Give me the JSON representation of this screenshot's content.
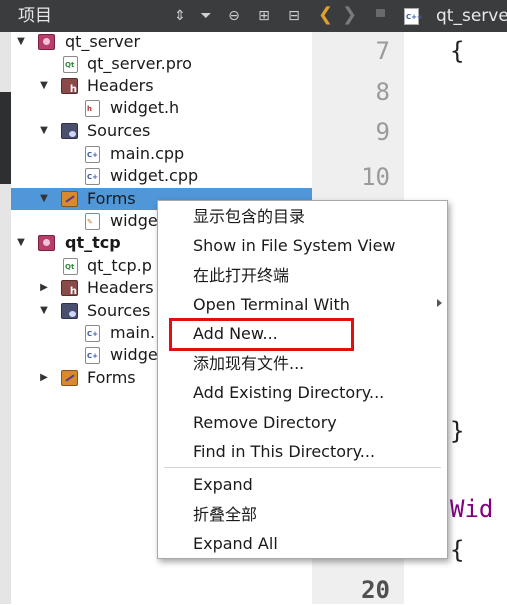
{
  "panel": {
    "title": "项目",
    "header_icons": [
      "sort-icon",
      "filter-icon",
      "link-icon",
      "split-icon",
      "close-pane-icon"
    ]
  },
  "tree": [
    {
      "label": "qt_server",
      "icon": "qt-project-icon",
      "expanded": true
    },
    {
      "label": "qt_server.pro",
      "icon": "pro-file-icon"
    },
    {
      "label": "Headers",
      "icon": "headers-folder-icon",
      "expanded": true
    },
    {
      "label": "widget.h",
      "icon": "header-file-icon"
    },
    {
      "label": "Sources",
      "icon": "sources-folder-icon",
      "expanded": true
    },
    {
      "label": "main.cpp",
      "icon": "cpp-file-icon"
    },
    {
      "label": "widget.cpp",
      "icon": "cpp-file-icon"
    },
    {
      "label": "Forms",
      "icon": "forms-folder-icon",
      "expanded": true,
      "selected": true
    },
    {
      "label": "widge",
      "icon": "ui-file-icon"
    },
    {
      "label": "qt_tcp",
      "icon": "qt-project-icon",
      "expanded": true
    },
    {
      "label": "qt_tcp.p",
      "icon": "pro-file-icon"
    },
    {
      "label": "Headers",
      "icon": "headers-folder-icon",
      "expanded": false
    },
    {
      "label": "Sources",
      "icon": "sources-folder-icon",
      "expanded": true
    },
    {
      "label": "main.",
      "icon": "cpp-file-icon"
    },
    {
      "label": "widge",
      "icon": "cpp-file-icon"
    },
    {
      "label": "Forms",
      "icon": "forms-folder-icon",
      "expanded": false
    }
  ],
  "editor": {
    "filename": "qt_serve",
    "tag": "C++",
    "line_numbers": [
      "7",
      "8",
      "9",
      "10",
      "20"
    ],
    "code": {
      "line7": "{",
      "brace_close": "}",
      "keyword": "Wid",
      "brace_open": "{"
    }
  },
  "context_menu": {
    "items": [
      "显示包含的目录",
      "Show in File System View",
      "在此打开终端",
      "Open Terminal With",
      "Add New...",
      "添加现有文件...",
      "Add Existing Directory...",
      "Remove Directory",
      "Find in This Directory...",
      "Expand",
      "折叠全部",
      "Expand All"
    ]
  },
  "colors": {
    "selection": "#4f97d8",
    "highlight_box": "#e01010",
    "header_bg": "#3b3c3e"
  }
}
